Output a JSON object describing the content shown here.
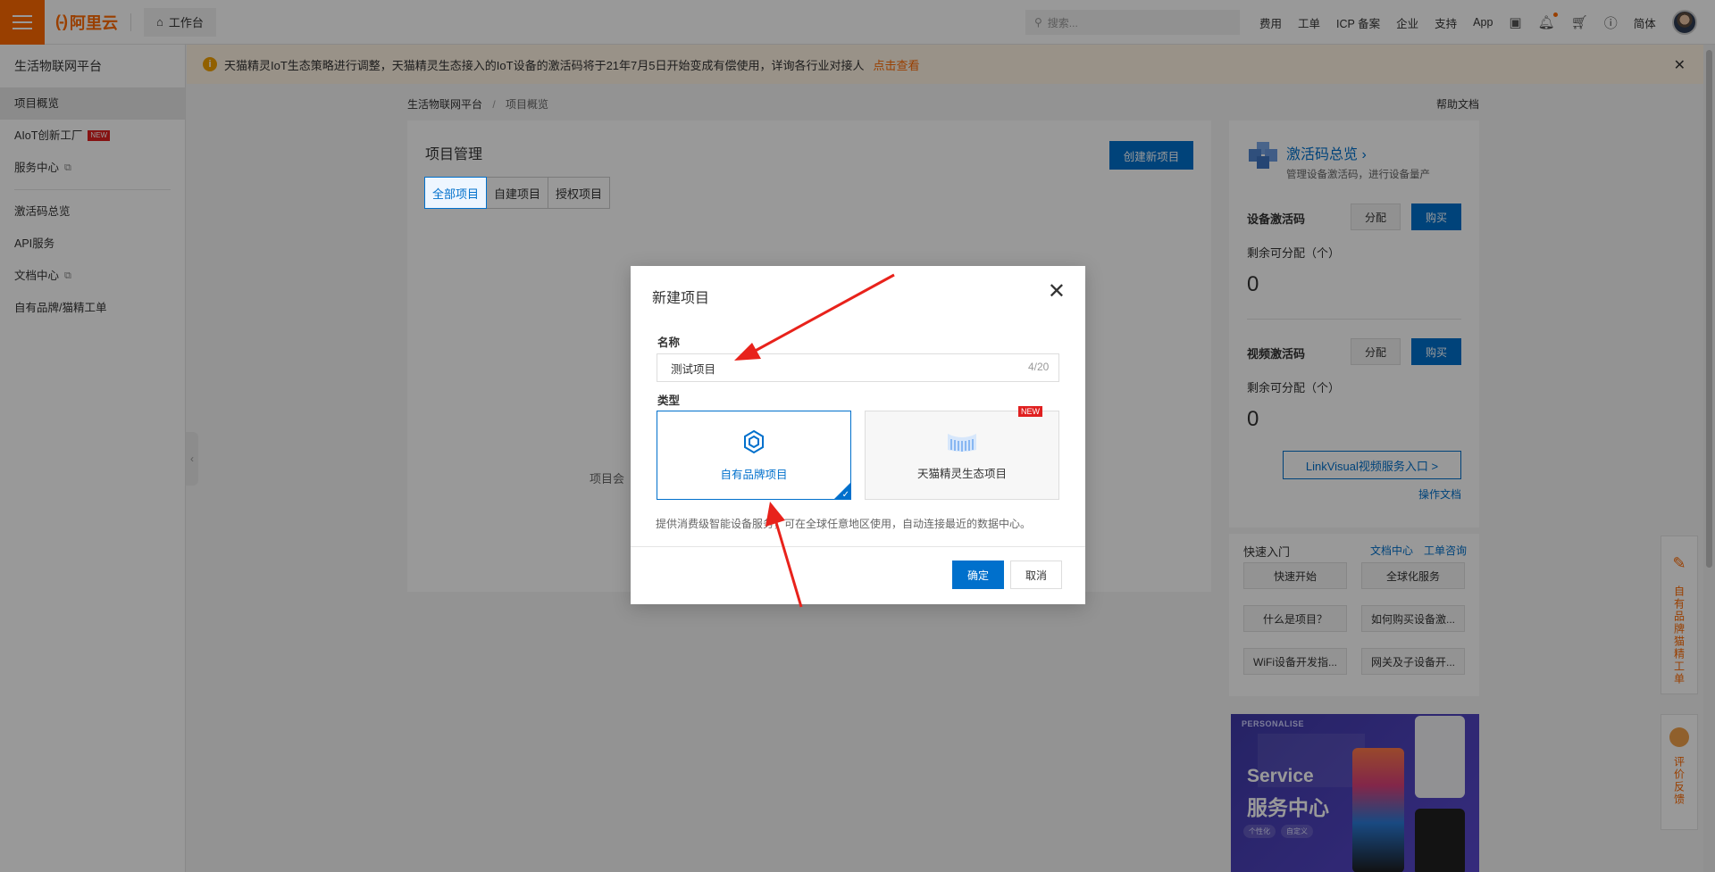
{
  "topbar": {
    "logo_mark": "(-)",
    "logo_text": "阿里云",
    "workbench": "工作台",
    "search_placeholder": "搜索...",
    "links": [
      "费用",
      "工单",
      "ICP 备案",
      "企业",
      "支持",
      "App"
    ],
    "lang": "简体"
  },
  "sidebar": {
    "title": "生活物联网平台",
    "items": [
      {
        "label": "项目概览"
      },
      {
        "label": "AIoT创新工厂",
        "badge": "NEW"
      },
      {
        "label": "服务中心"
      },
      {
        "label": "激活码总览"
      },
      {
        "label": "API服务"
      },
      {
        "label": "文档中心"
      },
      {
        "label": "自有品牌/猫精工单"
      }
    ]
  },
  "notice": {
    "text": "天猫精灵IoT生态策略进行调整，天猫精灵生态接入的IoT设备的激活码将于21年7月5日开始变成有偿使用，详询各行业对接人",
    "link": "点击查看"
  },
  "breadcrumb": {
    "root": "生活物联网平台",
    "sep": "/",
    "current": "项目概览"
  },
  "help_doc": "帮助文档",
  "main": {
    "title": "项目管理",
    "create_btn": "创建新项目",
    "tabs": [
      "全部项目",
      "自建项目",
      "授权项目"
    ],
    "empty_text": "项目会"
  },
  "activation": {
    "title": "激活码总览",
    "chevron": "›",
    "subtitle": "管理设备激活码，进行设备量产",
    "device_label": "设备激活码",
    "video_label": "视频激活码",
    "assign": "分配",
    "buy": "购买",
    "remain": "剩余可分配（个）",
    "device_count": "0",
    "video_count": "0",
    "linkvisual": "LinkVisual视频服务入口  >",
    "op_doc": "操作文档"
  },
  "quick": {
    "title": "快速入门",
    "link_doc": "文档中心",
    "link_ticket": "工单咨询",
    "buttons": [
      "快速开始",
      "全球化服务",
      "什么是项目？",
      "如何购买设备激...",
      "WiFi设备开发指...",
      "网关及子设备开..."
    ]
  },
  "banner": {
    "tag": "PERSONALISE",
    "en": "Service",
    "cn": "服务中心",
    "chip1": "个性化",
    "chip2": "自定义"
  },
  "float": {
    "ticket": "自有品牌猫精工单",
    "feedback": "评价反馈"
  },
  "modal": {
    "title": "新建项目",
    "name_label": "名称",
    "name_value": "测试项目",
    "counter": "4/20",
    "type_label": "类型",
    "type_own": "自有品牌项目",
    "type_tmall": "天猫精灵生态项目",
    "new_badge": "NEW",
    "description": "提供消费级智能设备服务，可在全球任意地区使用，自动连接最近的数据中心。",
    "ok": "确定",
    "cancel": "取消"
  },
  "colors": {
    "brand": "#ff6a00",
    "primary": "#0070cc",
    "annotation": "#e8221b"
  }
}
